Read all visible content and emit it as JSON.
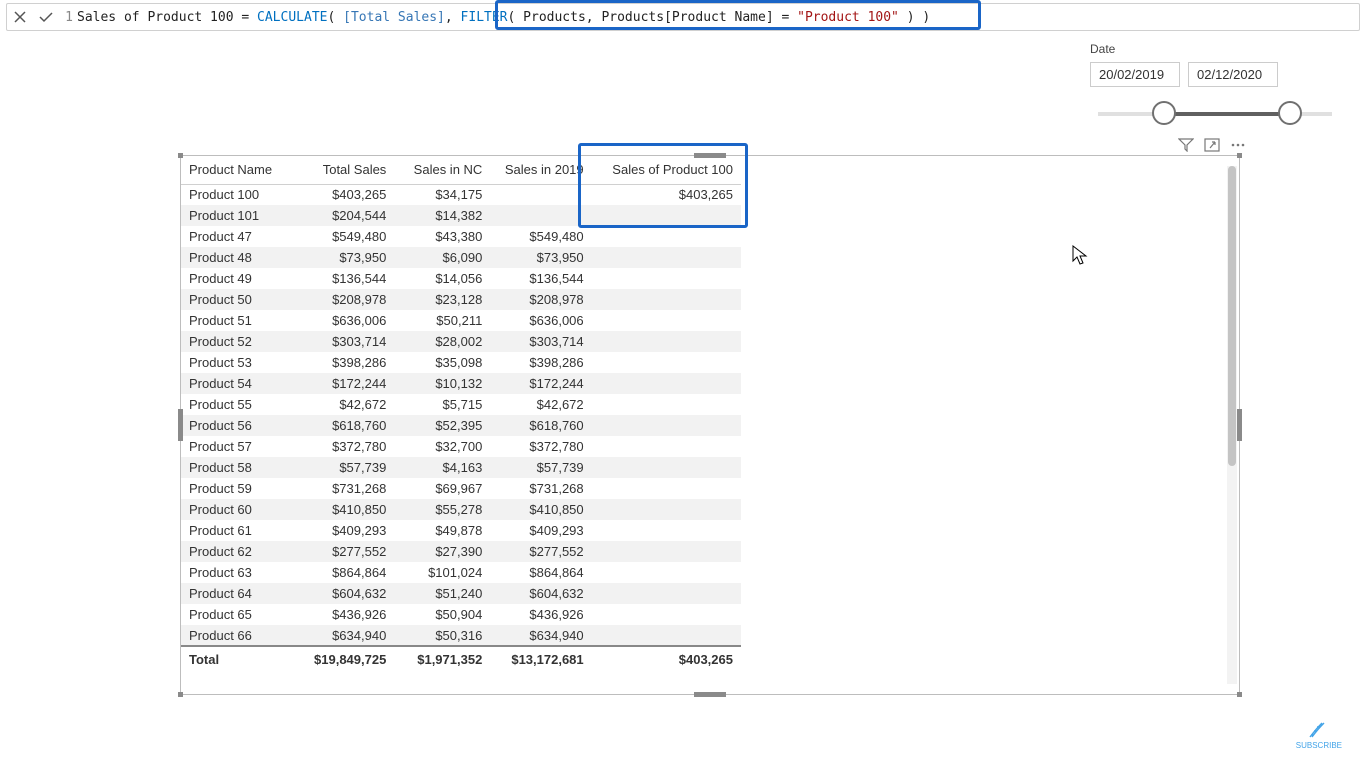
{
  "formula_bar": {
    "line_num": "1",
    "tokens": {
      "measure_name": "Sales of Product 100",
      "eq": " = ",
      "calc": "CALCULATE",
      "p1": "( ",
      "total_sales": "[Total Sales]",
      "comma": ", ",
      "filter": "FILTER",
      "p2": "( ",
      "tbl": "Products",
      "comma2": ", ",
      "col": "Products[Product Name]",
      "eq2": " = ",
      "str": "\"Product 100\"",
      "close": " ) )"
    }
  },
  "date_slicer": {
    "label": "Date",
    "from": "20/02/2019",
    "to": "02/12/2020"
  },
  "table": {
    "headers": {
      "c0": "Product Name",
      "c1": "Total Sales",
      "c2": "Sales in NC",
      "c3": "Sales in 2019",
      "c4": "Sales of Product 100"
    },
    "rows": [
      {
        "name": "Product 100",
        "ts": "$403,265",
        "nc": "$34,175",
        "y19": "",
        "p100": "$403,265"
      },
      {
        "name": "Product 101",
        "ts": "$204,544",
        "nc": "$14,382",
        "y19": "",
        "p100": ""
      },
      {
        "name": "Product 47",
        "ts": "$549,480",
        "nc": "$43,380",
        "y19": "$549,480",
        "p100": ""
      },
      {
        "name": "Product 48",
        "ts": "$73,950",
        "nc": "$6,090",
        "y19": "$73,950",
        "p100": ""
      },
      {
        "name": "Product 49",
        "ts": "$136,544",
        "nc": "$14,056",
        "y19": "$136,544",
        "p100": ""
      },
      {
        "name": "Product 50",
        "ts": "$208,978",
        "nc": "$23,128",
        "y19": "$208,978",
        "p100": ""
      },
      {
        "name": "Product 51",
        "ts": "$636,006",
        "nc": "$50,211",
        "y19": "$636,006",
        "p100": ""
      },
      {
        "name": "Product 52",
        "ts": "$303,714",
        "nc": "$28,002",
        "y19": "$303,714",
        "p100": ""
      },
      {
        "name": "Product 53",
        "ts": "$398,286",
        "nc": "$35,098",
        "y19": "$398,286",
        "p100": ""
      },
      {
        "name": "Product 54",
        "ts": "$172,244",
        "nc": "$10,132",
        "y19": "$172,244",
        "p100": ""
      },
      {
        "name": "Product 55",
        "ts": "$42,672",
        "nc": "$5,715",
        "y19": "$42,672",
        "p100": ""
      },
      {
        "name": "Product 56",
        "ts": "$618,760",
        "nc": "$52,395",
        "y19": "$618,760",
        "p100": ""
      },
      {
        "name": "Product 57",
        "ts": "$372,780",
        "nc": "$32,700",
        "y19": "$372,780",
        "p100": ""
      },
      {
        "name": "Product 58",
        "ts": "$57,739",
        "nc": "$4,163",
        "y19": "$57,739",
        "p100": ""
      },
      {
        "name": "Product 59",
        "ts": "$731,268",
        "nc": "$69,967",
        "y19": "$731,268",
        "p100": ""
      },
      {
        "name": "Product 60",
        "ts": "$410,850",
        "nc": "$55,278",
        "y19": "$410,850",
        "p100": ""
      },
      {
        "name": "Product 61",
        "ts": "$409,293",
        "nc": "$49,878",
        "y19": "$409,293",
        "p100": ""
      },
      {
        "name": "Product 62",
        "ts": "$277,552",
        "nc": "$27,390",
        "y19": "$277,552",
        "p100": ""
      },
      {
        "name": "Product 63",
        "ts": "$864,864",
        "nc": "$101,024",
        "y19": "$864,864",
        "p100": ""
      },
      {
        "name": "Product 64",
        "ts": "$604,632",
        "nc": "$51,240",
        "y19": "$604,632",
        "p100": ""
      },
      {
        "name": "Product 65",
        "ts": "$436,926",
        "nc": "$50,904",
        "y19": "$436,926",
        "p100": ""
      },
      {
        "name": "Product 66",
        "ts": "$634,940",
        "nc": "$50,316",
        "y19": "$634,940",
        "p100": ""
      }
    ],
    "totals": {
      "label": "Total",
      "ts": "$19,849,725",
      "nc": "$1,971,352",
      "y19": "$13,172,681",
      "p100": "$403,265"
    }
  },
  "watermark_label": "SUBSCRIBE"
}
